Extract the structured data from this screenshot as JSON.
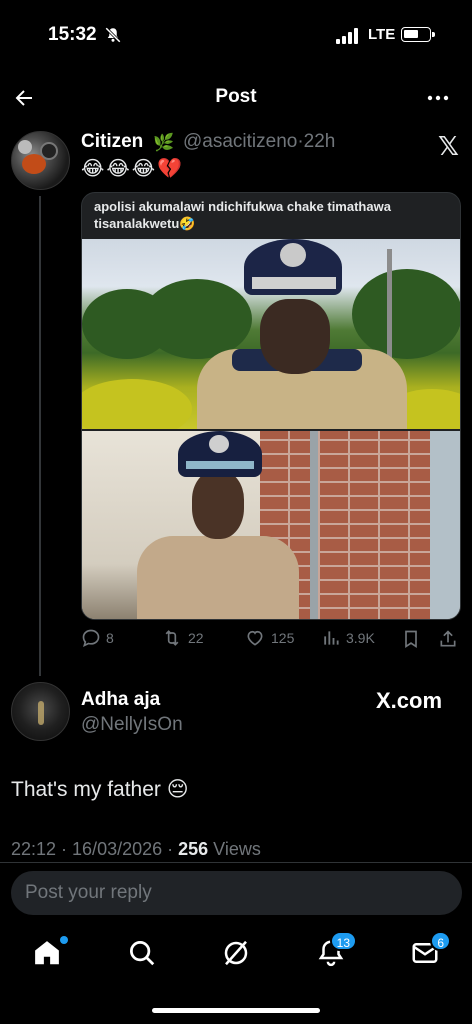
{
  "status": {
    "time": "15:32",
    "network": "LTE"
  },
  "header": {
    "title": "Post"
  },
  "quoted": {
    "name": "Citizen",
    "leaf": "🌿",
    "handle": "@asacitizeno",
    "time": "22h",
    "emojis": "😂😂😂💔",
    "caption": "apolisi akumalawi ndichifukwa chake timathawa tisanalakwetu🤣",
    "stats": {
      "replies": "8",
      "reposts": "22",
      "likes": "125",
      "views": "3.9K"
    }
  },
  "reply_author": {
    "name": "Adha aja",
    "handle": "@NellyIsOn",
    "brand": "X.com"
  },
  "reply": {
    "text": "That's my father 😔",
    "datetime": "22:12 · 16/03/2026 · ",
    "views_count": "256",
    "views_label": " Views"
  },
  "composer": {
    "placeholder": "Post your reply"
  },
  "tabbar": {
    "notifications_badge": "13",
    "messages_badge": "6"
  },
  "icons": [
    "back-arrow-icon",
    "more-icon",
    "x-logo-icon",
    "reply-icon",
    "repost-icon",
    "like-icon",
    "views-icon",
    "bookmark-icon",
    "share-icon",
    "home-icon",
    "search-icon",
    "grok-icon",
    "bell-icon",
    "mail-icon"
  ],
  "colors": {
    "accent": "#1d9bf0",
    "muted": "#71767b",
    "background": "#000000"
  }
}
